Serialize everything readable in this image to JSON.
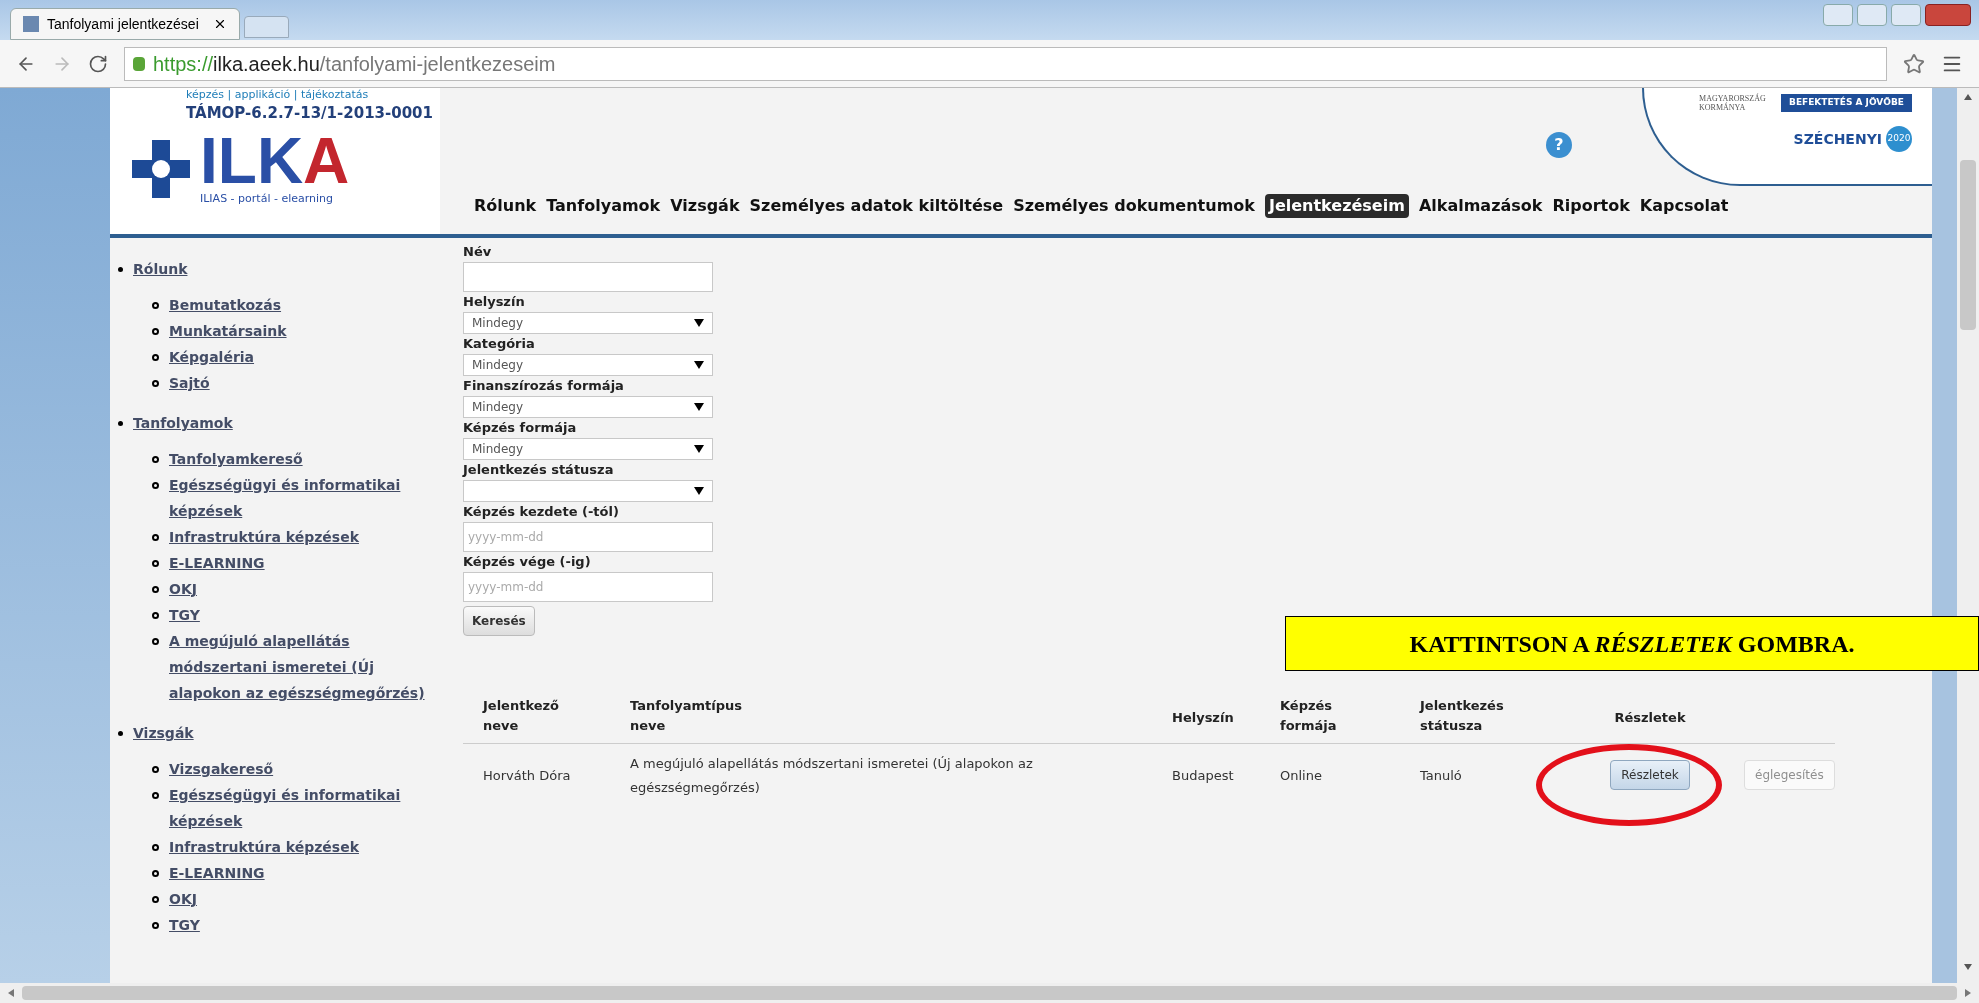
{
  "browser": {
    "tab_title": "Tanfolyami jelentkezései",
    "url_scheme": "https://",
    "url_host": "ilka.aeek.hu",
    "url_path": "/tanfolyami-jelentkezeseim"
  },
  "header": {
    "tagline": "képzés | applikáció | tájékoztatás",
    "project_code": "TÁMOP-6.2.7-13/1-2013-0001",
    "logo_main": "ILK",
    "logo_accent": "A",
    "logo_subtitle": "ILIAS - portál - elearning",
    "gov_name": "MAGYARORSZÁG KORMÁNYA",
    "gov_slogan": "BEFEKTETÉS A JÖVŐBE",
    "program_name": "SZÉCHENYI",
    "program_year": "2020",
    "help_label": "?"
  },
  "nav": [
    {
      "label": "Rólunk",
      "selected": false
    },
    {
      "label": "Tanfolyamok",
      "selected": false
    },
    {
      "label": "Vizsgák",
      "selected": false
    },
    {
      "label": "Személyes adatok kiltöltése",
      "selected": false
    },
    {
      "label": "Személyes dokumentumok",
      "selected": false
    },
    {
      "label": "Jelentkezéseim",
      "selected": true
    },
    {
      "label": "Alkalmazások",
      "selected": false
    },
    {
      "label": "Riportok",
      "selected": false
    },
    {
      "label": "Kapcsolat",
      "selected": false
    }
  ],
  "sidebar": [
    {
      "label": "Rólunk",
      "children": [
        {
          "label": "Bemutatkozás"
        },
        {
          "label": "Munkatársaink"
        },
        {
          "label": "Képgaléria"
        },
        {
          "label": "Sajtó"
        }
      ]
    },
    {
      "label": "Tanfolyamok",
      "children": [
        {
          "label": "Tanfolyamkereső"
        },
        {
          "label": "Egészségügyi és informatikai képzések"
        },
        {
          "label": "Infrastruktúra képzések"
        },
        {
          "label": "E-LEARNING"
        },
        {
          "label": "OKJ"
        },
        {
          "label": "TGY"
        },
        {
          "label": "A megújuló alapellátás módszertani ismeretei (Új alapokon az egészségmegőrzés)"
        }
      ]
    },
    {
      "label": "Vizsgák",
      "children": [
        {
          "label": "Vizsgakereső"
        },
        {
          "label": "Egészségügyi és informatikai képzések"
        },
        {
          "label": "Infrastruktúra képzések"
        },
        {
          "label": "E-LEARNING"
        },
        {
          "label": "OKJ"
        },
        {
          "label": "TGY"
        }
      ]
    }
  ],
  "filters": [
    {
      "label": "Név",
      "kind": "text"
    },
    {
      "label": "Helyszín",
      "kind": "select",
      "value": "Mindegy"
    },
    {
      "label": "Kategória",
      "kind": "select",
      "value": "Mindegy"
    },
    {
      "label": "Finanszírozás formája",
      "kind": "select",
      "value": "Mindegy"
    },
    {
      "label": "Képzés formája",
      "kind": "select",
      "value": "Mindegy"
    },
    {
      "label": "Jelentkezés státusza",
      "kind": "select"
    },
    {
      "label": "Képzés kezdete (-tól)",
      "kind": "text",
      "placeholder": "yyyy-mm-dd"
    },
    {
      "label": "Képzés vége (-ig)",
      "kind": "text",
      "placeholder": "yyyy-mm-dd"
    }
  ],
  "search_button": "Keresés",
  "callout": "KATTINTSON A *RÉSZLETEK* GOMBRA.",
  "table": {
    "columns": [
      "Jelentkező neve",
      "Tanfolyamtípus neve",
      "Helyszín",
      "Képzés formája",
      "Jelentkezés státusza",
      "Részletek"
    ],
    "rows": [
      {
        "cells": [
          "Horváth Dóra",
          "A megújuló alapellátás módszertani ismeretei (Új alapokon az egészségmegőrzés)",
          "Budapest",
          "Online",
          "Tanuló"
        ],
        "details_button": "Részletek",
        "finalize_button": "églegesítés",
        "finalize_disabled": true
      }
    ]
  }
}
